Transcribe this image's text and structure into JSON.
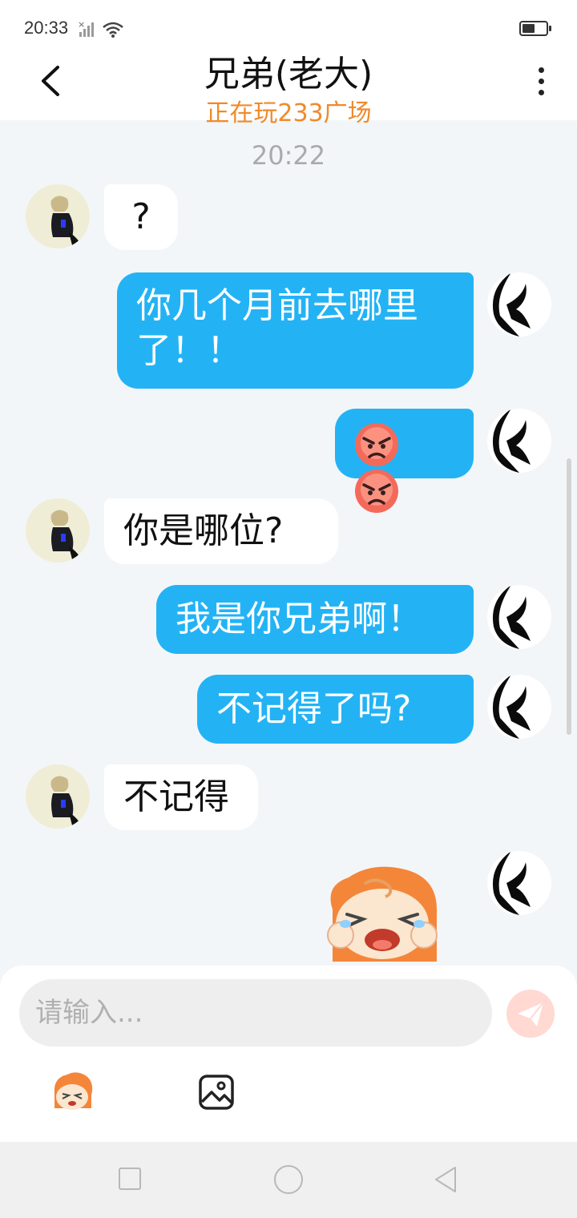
{
  "status_bar": {
    "time": "20:33"
  },
  "header": {
    "title": "兄弟(老大)",
    "subtitle": "正在玩233广场"
  },
  "chat": {
    "timestamp": "20:22",
    "messages": [
      {
        "from": "friend",
        "text": "?"
      },
      {
        "from": "me",
        "lines": [
          "你几个月前去哪里",
          "了！！"
        ]
      },
      {
        "from": "me",
        "emoji": [
          "angry-face-icon",
          "angry-face-icon"
        ]
      },
      {
        "from": "friend",
        "text": "你是哪位?"
      },
      {
        "from": "me",
        "text": "我是你兄弟啊！"
      },
      {
        "from": "me",
        "text": "不记得了吗?"
      },
      {
        "from": "friend",
        "text": "不记得"
      },
      {
        "from": "me",
        "sticker": "crying-mascot-sticker"
      }
    ]
  },
  "composer": {
    "placeholder": "请输入..."
  },
  "colors": {
    "outgoing_bubble": "#23b3f5",
    "subtitle": "#f08a2a",
    "send_button": "#ffd9d2"
  }
}
